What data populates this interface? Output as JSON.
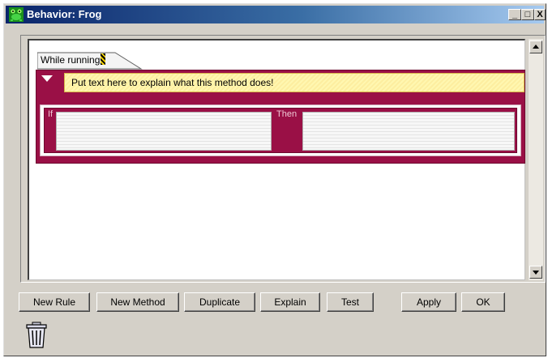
{
  "window": {
    "title": "Behavior: Frog",
    "controls": {
      "minimize": "_",
      "maximize": "□",
      "close": "X"
    },
    "app_icon": "frog-icon"
  },
  "method": {
    "tab_label": "While running",
    "tab_edit_icon": "edit-pencil-icon",
    "comment_placeholder": "Put text here to explain what this method does!",
    "rule": {
      "if_label": "If",
      "then_label": "Then"
    }
  },
  "buttons": {
    "new_rule": "New Rule",
    "new_method": "New Method",
    "duplicate": "Duplicate",
    "explain": "Explain",
    "test": "Test",
    "apply": "Apply",
    "ok": "OK"
  },
  "icons": {
    "trash": "trash-can-icon",
    "scroll_up": "scroll-up-arrow-icon",
    "scroll_down": "scroll-down-arrow-icon",
    "collapse": "collapse-triangle-icon"
  },
  "colors": {
    "method_block": "#9a1046",
    "comment_background": "#fff7b0",
    "title_bar_start": "#0a246a",
    "title_bar_end": "#a6caf0"
  }
}
